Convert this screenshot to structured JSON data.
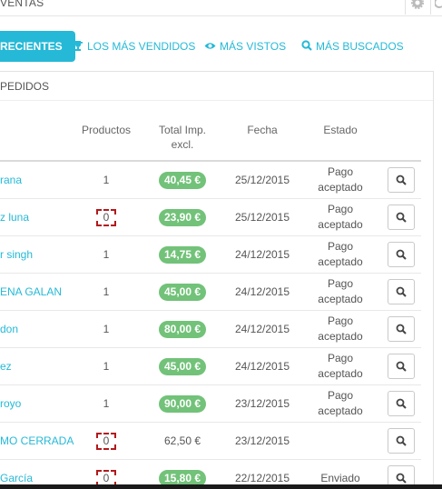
{
  "header": {
    "title": "VENTAS",
    "settings_icon": "gear-icon",
    "refresh_icon": "refresh-icon"
  },
  "tabs": [
    {
      "label": "RECIENTES",
      "icon": "none",
      "active": true
    },
    {
      "label": "LOS MÁS VENDIDOS",
      "icon": "trophy-icon",
      "active": false
    },
    {
      "label": "MÁS VISTOS",
      "icon": "eye-icon",
      "active": false
    },
    {
      "label": "MÁS BUSCADOS",
      "icon": "search-icon",
      "active": false
    }
  ],
  "panel": {
    "title": "PEDIDOS"
  },
  "table": {
    "headers": {
      "products": "Productos",
      "total_line1": "Total Imp.",
      "total_line2": "excl.",
      "date": "Fecha",
      "state": "Estado"
    },
    "rows": [
      {
        "customer": "rana",
        "products": "1",
        "total": "40,45 €",
        "total_badge": true,
        "date": "25/12/2015",
        "state_line1": "Pago",
        "state_line2": "aceptado",
        "highlight_products": false
      },
      {
        "customer": "z luna",
        "products": "0",
        "total": "23,90 €",
        "total_badge": true,
        "date": "25/12/2015",
        "state_line1": "Pago",
        "state_line2": "aceptado",
        "highlight_products": true
      },
      {
        "customer": "r singh",
        "products": "1",
        "total": "14,75 €",
        "total_badge": true,
        "date": "24/12/2015",
        "state_line1": "Pago",
        "state_line2": "aceptado",
        "highlight_products": false
      },
      {
        "customer": "ENA GALAN",
        "products": "1",
        "total": "45,00 €",
        "total_badge": true,
        "date": "24/12/2015",
        "state_line1": "Pago",
        "state_line2": "aceptado",
        "highlight_products": false
      },
      {
        "customer": "don",
        "products": "1",
        "total": "80,00 €",
        "total_badge": true,
        "date": "24/12/2015",
        "state_line1": "Pago",
        "state_line2": "aceptado",
        "highlight_products": false
      },
      {
        "customer": "ez",
        "products": "1",
        "total": "45,00 €",
        "total_badge": true,
        "date": "24/12/2015",
        "state_line1": "Pago",
        "state_line2": "aceptado",
        "highlight_products": false
      },
      {
        "customer": "royo",
        "products": "1",
        "total": "90,00 €",
        "total_badge": true,
        "date": "23/12/2015",
        "state_line1": "Pago",
        "state_line2": "aceptado",
        "highlight_products": false
      },
      {
        "customer": "MO CERRADA",
        "products": "0",
        "total": "62,50 €",
        "total_badge": false,
        "date": "23/12/2015",
        "state_line1": "",
        "state_line2": "",
        "highlight_products": true
      },
      {
        "customer": "García",
        "products": "0",
        "total": "15,80 €",
        "total_badge": true,
        "date": "22/12/2015",
        "state_line1": "Enviado",
        "state_line2": "",
        "highlight_products": true
      }
    ]
  },
  "colors": {
    "accent": "#25b9d7",
    "success_badge": "#72c279",
    "highlight_box": "#b3191c"
  }
}
